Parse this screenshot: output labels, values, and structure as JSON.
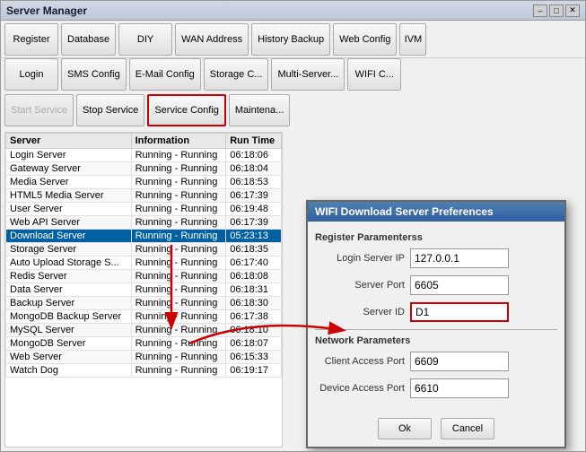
{
  "window": {
    "title": "Server Manager",
    "title_btns": [
      "–",
      "□",
      "✕"
    ]
  },
  "toolbar1": {
    "buttons": [
      {
        "label": "Register",
        "name": "register-button",
        "disabled": false,
        "red_border": false
      },
      {
        "label": "Database",
        "name": "database-button",
        "disabled": false,
        "red_border": false
      },
      {
        "label": "DIY",
        "name": "diy-button",
        "disabled": false,
        "red_border": false
      },
      {
        "label": "WAN Address",
        "name": "wan-address-button",
        "disabled": false,
        "red_border": false
      },
      {
        "label": "History Backup",
        "name": "history-backup-button",
        "disabled": false,
        "red_border": false
      },
      {
        "label": "Web Config",
        "name": "web-config-button",
        "disabled": false,
        "red_border": false
      }
    ],
    "ivm": "IVM"
  },
  "toolbar2": {
    "buttons": [
      {
        "label": "Login",
        "name": "login-button"
      },
      {
        "label": "SMS Config",
        "name": "sms-config-button"
      },
      {
        "label": "E-Mail Config",
        "name": "email-config-button"
      },
      {
        "label": "Storage C...",
        "name": "storage-config-button"
      },
      {
        "label": "Multi-Server...",
        "name": "multi-server-button"
      },
      {
        "label": "WIFI C...",
        "name": "wifi-config-button"
      }
    ]
  },
  "action_bar": {
    "buttons": [
      {
        "label": "Start Service",
        "name": "start-service-button",
        "disabled": true,
        "red_border": false
      },
      {
        "label": "Stop Service",
        "name": "stop-service-button",
        "disabled": false,
        "red_border": false
      },
      {
        "label": "Service Config",
        "name": "service-config-button",
        "disabled": false,
        "red_border": true
      },
      {
        "label": "Maintena...",
        "name": "maintenance-button",
        "disabled": false,
        "red_border": false
      }
    ]
  },
  "table": {
    "headers": [
      "Server",
      "Information",
      "Run Time"
    ],
    "rows": [
      {
        "server": "Login Server",
        "info": "Running - Running",
        "time": "06:18:06",
        "highlight": false
      },
      {
        "server": "Gateway Server",
        "info": "Running - Running",
        "time": "06:18:04",
        "highlight": false
      },
      {
        "server": "Media Server",
        "info": "Running - Running",
        "time": "06:18:53",
        "highlight": false
      },
      {
        "server": "HTML5 Media Server",
        "info": "Running - Running",
        "time": "06:17:39",
        "highlight": false
      },
      {
        "server": "User Server",
        "info": "Running - Running",
        "time": "06:19:48",
        "highlight": false
      },
      {
        "server": "Web API Server",
        "info": "Running - Running",
        "time": "06:17:39",
        "highlight": false
      },
      {
        "server": "Download Server",
        "info": "Running - Running",
        "time": "05:23:13",
        "highlight": true
      },
      {
        "server": "Storage Server",
        "info": "Running - Running",
        "time": "06:18:35",
        "highlight": false
      },
      {
        "server": "Auto Upload Storage S...",
        "info": "Running - Running",
        "time": "06:17:40",
        "highlight": false
      },
      {
        "server": "Redis Server",
        "info": "Running - Running",
        "time": "06:18:08",
        "highlight": false
      },
      {
        "server": "Data Server",
        "info": "Running - Running",
        "time": "06:18:31",
        "highlight": false
      },
      {
        "server": "Backup Server",
        "info": "Running - Running",
        "time": "06:18:30",
        "highlight": false
      },
      {
        "server": "MongoDB Backup Server",
        "info": "Running - Running",
        "time": "06:17:38",
        "highlight": false
      },
      {
        "server": "MySQL Server",
        "info": "Running - Running",
        "time": "06:18:10",
        "highlight": false
      },
      {
        "server": "MongoDB Server",
        "info": "Running - Running",
        "time": "06:18:07",
        "highlight": false
      },
      {
        "server": "Web Server",
        "info": "Running - Running",
        "time": "06:15:33",
        "highlight": false
      },
      {
        "server": "Watch Dog",
        "info": "Running - Running",
        "time": "06:19:17",
        "highlight": false
      }
    ]
  },
  "dialog": {
    "title": "WIFI Download Server Preferences",
    "section1": "Register Paramenterss",
    "login_server_ip_label": "Login Server IP",
    "login_server_ip_value": "127.0.0.1",
    "server_port_label": "Server Port",
    "server_port_value": "6605",
    "server_id_label": "Server ID",
    "server_id_value": "D1",
    "section2": "Network Parameters",
    "client_access_port_label": "Client Access Port",
    "client_access_port_value": "6609",
    "device_access_port_label": "Device Access Port",
    "device_access_port_value": "6610",
    "ok_label": "Ok",
    "cancel_label": "Cancel"
  }
}
